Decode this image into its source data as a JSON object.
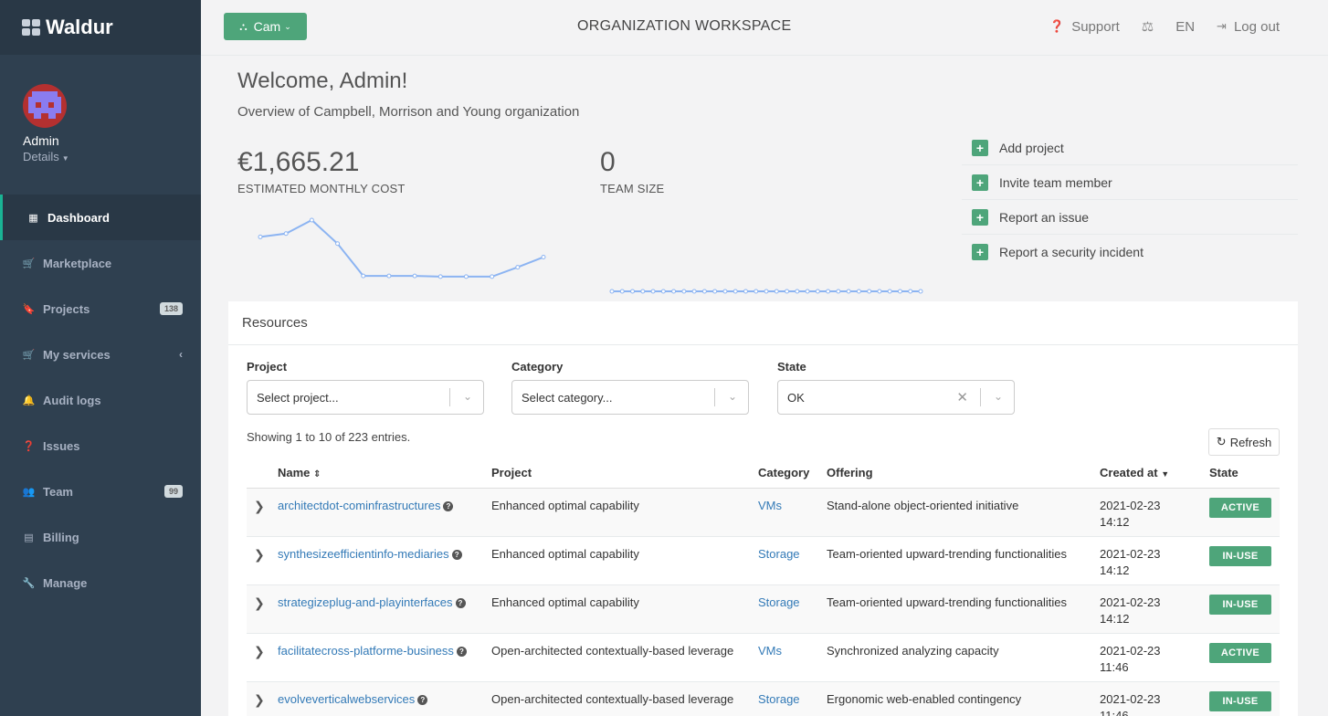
{
  "brand": {
    "name": "Waldur"
  },
  "user": {
    "name": "Admin",
    "details": "Details"
  },
  "sidebar": {
    "items": [
      {
        "label": "Dashboard",
        "icon": "dashboard-icon",
        "active": true
      },
      {
        "label": "Marketplace",
        "icon": "cart-icon"
      },
      {
        "label": "Projects",
        "icon": "bookmark-icon",
        "badge": "138"
      },
      {
        "label": "My services",
        "icon": "cart-icon",
        "chevron": true
      },
      {
        "label": "Audit logs",
        "icon": "bell-icon"
      },
      {
        "label": "Issues",
        "icon": "question-icon"
      },
      {
        "label": "Team",
        "icon": "users-icon",
        "badge": "99"
      },
      {
        "label": "Billing",
        "icon": "file-icon"
      },
      {
        "label": "Manage",
        "icon": "wrench-icon"
      }
    ]
  },
  "topbar": {
    "org_button": "Cam",
    "title": "ORGANIZATION WORKSPACE",
    "support": "Support",
    "language": "EN",
    "logout": "Log out"
  },
  "welcome": {
    "title": "Welcome, Admin!",
    "subtitle": "Overview of Campbell, Morrison and Young organization"
  },
  "stats": {
    "cost": {
      "value": "€1,665.21",
      "label": "ESTIMATED MONTHLY COST",
      "spark": [
        70,
        75,
        95,
        60,
        12,
        12,
        12,
        11,
        11,
        11,
        25,
        40
      ]
    },
    "team": {
      "value": "0",
      "label": "TEAM SIZE",
      "points": 31
    }
  },
  "actions": [
    "Add project",
    "Invite team member",
    "Report an issue",
    "Report a security incident"
  ],
  "resources": {
    "title": "Resources",
    "filters": {
      "project": {
        "label": "Project",
        "placeholder": "Select project..."
      },
      "category": {
        "label": "Category",
        "placeholder": "Select category..."
      },
      "state": {
        "label": "State",
        "value": "OK"
      }
    },
    "showing": "Showing 1 to 10 of 223 entries.",
    "refresh": "Refresh",
    "columns": {
      "name": "Name",
      "project": "Project",
      "category": "Category",
      "offering": "Offering",
      "created": "Created at",
      "state": "State"
    },
    "rows": [
      {
        "name": "architectdot-cominfrastructures",
        "project": "Enhanced optimal capability",
        "category": "VMs",
        "offering": "Stand-alone object-oriented initiative",
        "date": "2021-02-23",
        "time": "14:12",
        "state": "ACTIVE"
      },
      {
        "name": "synthesizeefficientinfo-mediaries",
        "project": "Enhanced optimal capability",
        "category": "Storage",
        "offering": "Team-oriented upward-trending functionalities",
        "date": "2021-02-23",
        "time": "14:12",
        "state": "IN-USE"
      },
      {
        "name": "strategizeplug-and-playinterfaces",
        "project": "Enhanced optimal capability",
        "category": "Storage",
        "offering": "Team-oriented upward-trending functionalities",
        "date": "2021-02-23",
        "time": "14:12",
        "state": "IN-USE"
      },
      {
        "name": "facilitatecross-platforme-business",
        "project": "Open-architected contextually-based leverage",
        "category": "VMs",
        "offering": "Synchronized analyzing capacity",
        "date": "2021-02-23",
        "time": "11:46",
        "state": "ACTIVE"
      },
      {
        "name": "evolveverticalwebservices",
        "project": "Open-architected contextually-based leverage",
        "category": "Storage",
        "offering": "Ergonomic web-enabled contingency",
        "date": "2021-02-23",
        "time": "11:46",
        "state": "IN-USE"
      }
    ]
  }
}
